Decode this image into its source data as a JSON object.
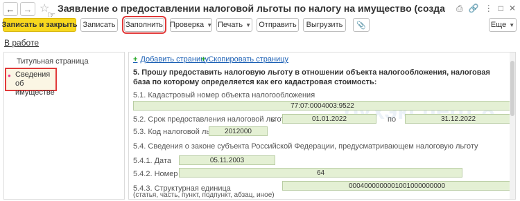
{
  "window": {
    "title": "Заявление о предоставлении налоговой льготы по налогу на имущество (создание) (ООО ..."
  },
  "toolbar": {
    "save_close": "Записать и закрыть",
    "save": "Записать",
    "fill": "Заполнить",
    "check": "Проверка",
    "print": "Печать",
    "send": "Отправить",
    "upload": "Выгрузить",
    "more": "Еще"
  },
  "status_link": "В работе",
  "sidebar": {
    "items": [
      {
        "label": "Титульная страница"
      },
      {
        "label": "Сведения об имуществе"
      }
    ]
  },
  "actions": {
    "add_page": "Добавить страницу",
    "copy_page": "Скопировать страницу"
  },
  "form": {
    "heading": "5. Прошу предоставить налоговую льготу в отношении объекта налогообложения, налоговая база по которому определяется как его кадастровая стоимость:",
    "cadastral_label": "5.1. Кадастровый номер объекта налогообложения",
    "cadastral_value": "77:07:0004003:9522",
    "period_label": "5.2. Срок предоставления налоговой льготы",
    "period_from_prefix": "с",
    "period_from": "01.01.2022",
    "period_to_prefix": "по",
    "period_to": "31.12.2022",
    "code_label": "5.3. Код налоговой льготы",
    "code_value": "2012000",
    "law_label": "5.4. Сведения о законе субъекта Российской Федерации, предусматривающем налоговую льготу",
    "date_label": "5.4.1. Дата",
    "date_value": "05.11.2003",
    "number_label": "5.4.2. Номер",
    "number_value": "64",
    "unit_label": "5.4.3. Структурная единица",
    "unit_hint": "(статья, часть, пункт, подпункт, абзац, иное)",
    "unit_value": "0004000000001001000000000"
  },
  "watermark": "бухэксперт 8"
}
